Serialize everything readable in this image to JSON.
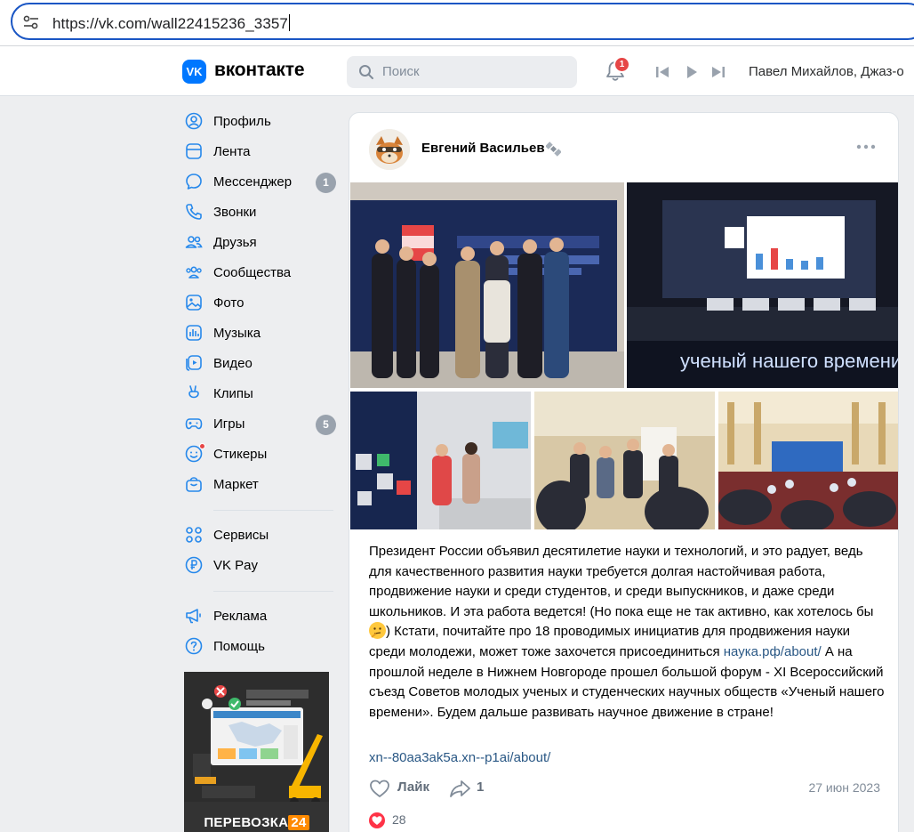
{
  "browser": {
    "url": "https://vk.com/wall22415236_3357"
  },
  "header": {
    "logo_text": "VK",
    "brand": "вконтакте",
    "search_placeholder": "Поиск",
    "notifications_count": "1",
    "now_playing": "Павел Михайлов, Джаз-о"
  },
  "sidebar": {
    "items": [
      {
        "label": "Профиль",
        "icon": "profile-icon"
      },
      {
        "label": "Лента",
        "icon": "feed-icon"
      },
      {
        "label": "Мессенджер",
        "icon": "messenger-icon",
        "count": "1"
      },
      {
        "label": "Звонки",
        "icon": "phone-icon"
      },
      {
        "label": "Друзья",
        "icon": "friends-icon"
      },
      {
        "label": "Сообщества",
        "icon": "communities-icon"
      },
      {
        "label": "Фото",
        "icon": "photo-icon"
      },
      {
        "label": "Музыка",
        "icon": "music-icon"
      },
      {
        "label": "Видео",
        "icon": "video-icon"
      },
      {
        "label": "Клипы",
        "icon": "clips-icon"
      },
      {
        "label": "Игры",
        "icon": "games-icon",
        "count": "5"
      },
      {
        "label": "Стикеры",
        "icon": "stickers-icon"
      },
      {
        "label": "Маркет",
        "icon": "market-icon"
      }
    ],
    "services": [
      {
        "label": "Сервисы",
        "icon": "services-icon"
      },
      {
        "label": "VK Pay",
        "icon": "vkpay-icon"
      }
    ],
    "extra": [
      {
        "label": "Реклама",
        "icon": "ads-icon"
      },
      {
        "label": "Помощь",
        "icon": "help-icon"
      }
    ],
    "ad_brand": "ПЕРЕВОЗКА",
    "ad_brand_num": "24"
  },
  "post": {
    "author": "Евгений Васильев",
    "photo_captions": {
      "photo2": "ученый нашего времени"
    },
    "text_part1": "Президент России объявил десятилетие науки и технологий, и это радует, ведь для качественного развития науки требуется долгая настойчивая работа, продвижение науки и среди студентов, и среди выпускников, и даже среди школьников. И эта работа ведется! (Но пока еще не так активно, как хотелось бы ",
    "text_part2": ") Кстати, почитайте про 18 проводимых инициатив для продвижения науки среди молодежи, может тоже захочется присоединиться ",
    "inline_link": "наука.рф/about/",
    "text_part3": " А на прошлой неделе в Нижнем Новгороде прошел большой форум - XI Всероссийский съезд Советов молодых ученых и студенческих научных обществ «Ученый нашего времени». Будем дальше развивать научное движение в стране!",
    "link": "xn--80aa3ak5a.xn--p1ai/about/",
    "like_label": "Лайк",
    "share_count": "1",
    "date": "27 июн 2023",
    "reactions_count": "28"
  },
  "colors": {
    "accent": "#0077ff",
    "link": "#2a5885",
    "badge_red": "#e64646",
    "background": "#edeef0"
  }
}
